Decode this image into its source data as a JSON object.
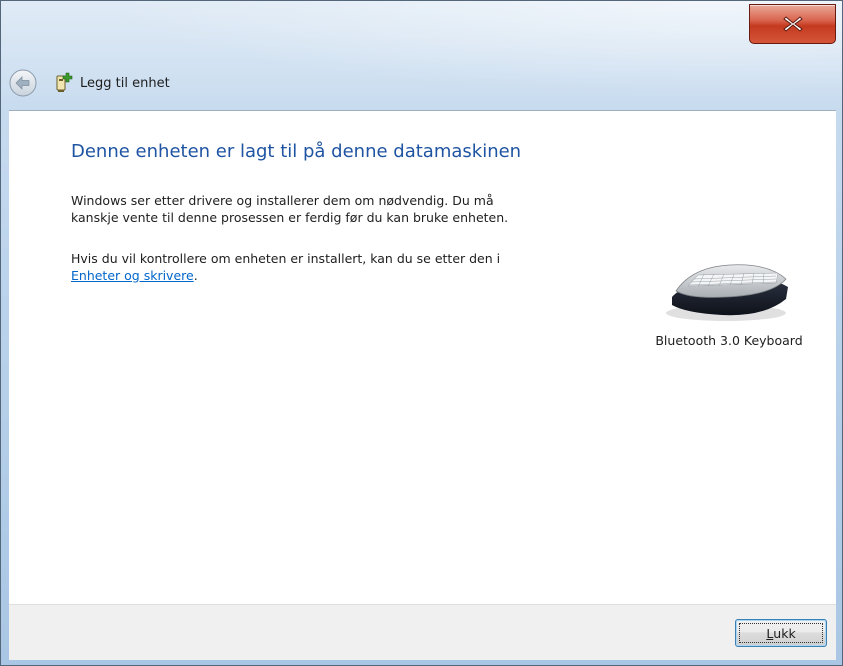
{
  "window": {
    "close_icon": "close-x-icon"
  },
  "nav": {
    "back_icon": "back-arrow-icon",
    "wizard_icon": "add-device-icon",
    "title": "Legg til enhet"
  },
  "main": {
    "headline": "Denne enheten er lagt til på denne datamaskinen",
    "para1_line1": "Windows ser etter drivere og installerer dem om nødvendig. Du må",
    "para1_line2": "kanskje vente til denne prosessen er ferdig før du kan bruke enheten.",
    "para2_text": "Hvis du vil kontrollere om enheten er installert, kan du se etter den i",
    "para2_link": "Enheter og skrivere",
    "para2_end": "."
  },
  "device": {
    "icon": "keyboard-icon",
    "label": "Bluetooth 3.0 Keyboard"
  },
  "footer": {
    "close_accel": "L",
    "close_rest": "ukk"
  },
  "colors": {
    "headline": "#1f54a3",
    "link": "#0066cc",
    "close_button": "#c43a1f"
  }
}
